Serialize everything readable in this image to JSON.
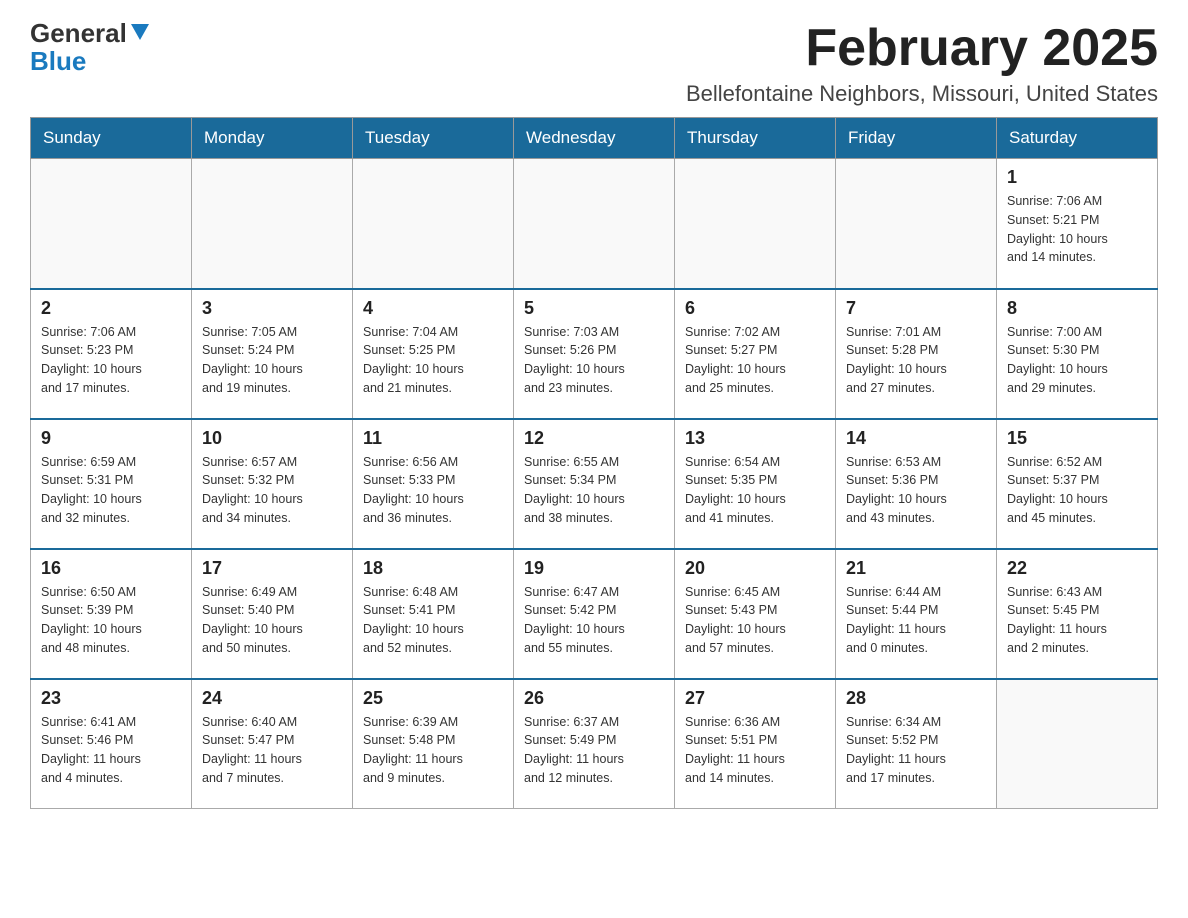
{
  "header": {
    "logo_general": "General",
    "logo_blue": "Blue",
    "title": "February 2025",
    "location": "Bellefontaine Neighbors, Missouri, United States"
  },
  "weekdays": [
    "Sunday",
    "Monday",
    "Tuesday",
    "Wednesday",
    "Thursday",
    "Friday",
    "Saturday"
  ],
  "weeks": [
    [
      {
        "day": "",
        "info": ""
      },
      {
        "day": "",
        "info": ""
      },
      {
        "day": "",
        "info": ""
      },
      {
        "day": "",
        "info": ""
      },
      {
        "day": "",
        "info": ""
      },
      {
        "day": "",
        "info": ""
      },
      {
        "day": "1",
        "info": "Sunrise: 7:06 AM\nSunset: 5:21 PM\nDaylight: 10 hours\nand 14 minutes."
      }
    ],
    [
      {
        "day": "2",
        "info": "Sunrise: 7:06 AM\nSunset: 5:23 PM\nDaylight: 10 hours\nand 17 minutes."
      },
      {
        "day": "3",
        "info": "Sunrise: 7:05 AM\nSunset: 5:24 PM\nDaylight: 10 hours\nand 19 minutes."
      },
      {
        "day": "4",
        "info": "Sunrise: 7:04 AM\nSunset: 5:25 PM\nDaylight: 10 hours\nand 21 minutes."
      },
      {
        "day": "5",
        "info": "Sunrise: 7:03 AM\nSunset: 5:26 PM\nDaylight: 10 hours\nand 23 minutes."
      },
      {
        "day": "6",
        "info": "Sunrise: 7:02 AM\nSunset: 5:27 PM\nDaylight: 10 hours\nand 25 minutes."
      },
      {
        "day": "7",
        "info": "Sunrise: 7:01 AM\nSunset: 5:28 PM\nDaylight: 10 hours\nand 27 minutes."
      },
      {
        "day": "8",
        "info": "Sunrise: 7:00 AM\nSunset: 5:30 PM\nDaylight: 10 hours\nand 29 minutes."
      }
    ],
    [
      {
        "day": "9",
        "info": "Sunrise: 6:59 AM\nSunset: 5:31 PM\nDaylight: 10 hours\nand 32 minutes."
      },
      {
        "day": "10",
        "info": "Sunrise: 6:57 AM\nSunset: 5:32 PM\nDaylight: 10 hours\nand 34 minutes."
      },
      {
        "day": "11",
        "info": "Sunrise: 6:56 AM\nSunset: 5:33 PM\nDaylight: 10 hours\nand 36 minutes."
      },
      {
        "day": "12",
        "info": "Sunrise: 6:55 AM\nSunset: 5:34 PM\nDaylight: 10 hours\nand 38 minutes."
      },
      {
        "day": "13",
        "info": "Sunrise: 6:54 AM\nSunset: 5:35 PM\nDaylight: 10 hours\nand 41 minutes."
      },
      {
        "day": "14",
        "info": "Sunrise: 6:53 AM\nSunset: 5:36 PM\nDaylight: 10 hours\nand 43 minutes."
      },
      {
        "day": "15",
        "info": "Sunrise: 6:52 AM\nSunset: 5:37 PM\nDaylight: 10 hours\nand 45 minutes."
      }
    ],
    [
      {
        "day": "16",
        "info": "Sunrise: 6:50 AM\nSunset: 5:39 PM\nDaylight: 10 hours\nand 48 minutes."
      },
      {
        "day": "17",
        "info": "Sunrise: 6:49 AM\nSunset: 5:40 PM\nDaylight: 10 hours\nand 50 minutes."
      },
      {
        "day": "18",
        "info": "Sunrise: 6:48 AM\nSunset: 5:41 PM\nDaylight: 10 hours\nand 52 minutes."
      },
      {
        "day": "19",
        "info": "Sunrise: 6:47 AM\nSunset: 5:42 PM\nDaylight: 10 hours\nand 55 minutes."
      },
      {
        "day": "20",
        "info": "Sunrise: 6:45 AM\nSunset: 5:43 PM\nDaylight: 10 hours\nand 57 minutes."
      },
      {
        "day": "21",
        "info": "Sunrise: 6:44 AM\nSunset: 5:44 PM\nDaylight: 11 hours\nand 0 minutes."
      },
      {
        "day": "22",
        "info": "Sunrise: 6:43 AM\nSunset: 5:45 PM\nDaylight: 11 hours\nand 2 minutes."
      }
    ],
    [
      {
        "day": "23",
        "info": "Sunrise: 6:41 AM\nSunset: 5:46 PM\nDaylight: 11 hours\nand 4 minutes."
      },
      {
        "day": "24",
        "info": "Sunrise: 6:40 AM\nSunset: 5:47 PM\nDaylight: 11 hours\nand 7 minutes."
      },
      {
        "day": "25",
        "info": "Sunrise: 6:39 AM\nSunset: 5:48 PM\nDaylight: 11 hours\nand 9 minutes."
      },
      {
        "day": "26",
        "info": "Sunrise: 6:37 AM\nSunset: 5:49 PM\nDaylight: 11 hours\nand 12 minutes."
      },
      {
        "day": "27",
        "info": "Sunrise: 6:36 AM\nSunset: 5:51 PM\nDaylight: 11 hours\nand 14 minutes."
      },
      {
        "day": "28",
        "info": "Sunrise: 6:34 AM\nSunset: 5:52 PM\nDaylight: 11 hours\nand 17 minutes."
      },
      {
        "day": "",
        "info": ""
      }
    ]
  ]
}
